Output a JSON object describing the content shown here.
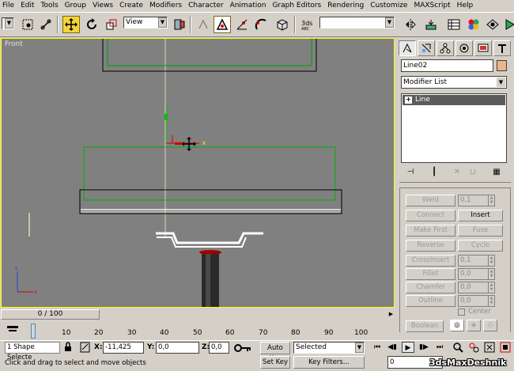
{
  "menubar": {
    "items": [
      "File",
      "Edit",
      "Tools",
      "Group",
      "Views",
      "Create",
      "Modifiers",
      "Character",
      "Animation",
      "Graph Editors",
      "Rendering",
      "Customize",
      "MAXScript",
      "Help"
    ]
  },
  "toolbar": {
    "view_combo": "View",
    "icons": [
      "undo-icon",
      "select-region-icon",
      "select-link-icon",
      "move-icon",
      "rotate-icon",
      "scale-icon",
      "named-selection-icon",
      "snap-icon",
      "mirror-icon",
      "align-icon",
      "material-editor-icon",
      "render-icon"
    ]
  },
  "viewport": {
    "label": "Front",
    "gizmo": {
      "x_label": "x",
      "y_label": "y"
    },
    "accent": "#ffff00"
  },
  "command_panel": {
    "object_name": "Line02",
    "object_color": "#f0b48c",
    "modifier_list": "Modifier List",
    "stack_item": "Line",
    "geometry": {
      "weld_label": "Weld",
      "weld_value": "0,1",
      "connect_label": "Connect",
      "insert_label": "Insert",
      "make_first_label": "Make First",
      "fuse_label": "Fuse",
      "reverse_label": "Reverse",
      "cycle_label": "Cycle",
      "crossinsert_label": "CrossInsert",
      "crossinsert_value": "0,1",
      "fillet_label": "Fillet",
      "fillet_value": "0,0",
      "chamfer_label": "Chamfer",
      "chamfer_value": "0,0",
      "outline_label": "Outline",
      "outline_value": "0,0",
      "center_label": "Center",
      "boolean_label": "Boolean"
    }
  },
  "timeline": {
    "slider_label": "0 / 100",
    "ticks": [
      "10",
      "20",
      "30",
      "40",
      "50",
      "60",
      "70",
      "80",
      "90",
      "100"
    ]
  },
  "status": {
    "selection": "1 Shape Selecte",
    "prompt": "Click and drag to select and move objects",
    "x_label": "X:",
    "x_value": "-11,425",
    "y_label": "Y:",
    "y_value": "0,0",
    "z_label": "Z:",
    "z_value": "0,0",
    "auto_key": "Auto Key",
    "set_key": "Set Key",
    "selected_combo": "Selected",
    "key_filters": "Key Filters...",
    "frame_value": "0",
    "watermark": "3dsMaxDeshnik"
  }
}
